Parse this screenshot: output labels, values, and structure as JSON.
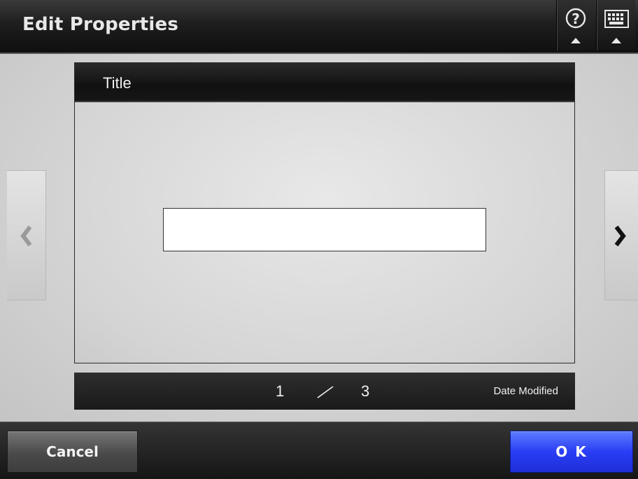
{
  "header": {
    "title": "Edit Properties",
    "help_icon": "help-question-icon",
    "keyboard_icon": "keyboard-icon"
  },
  "panel": {
    "title": "Title",
    "input_value": ""
  },
  "navigation": {
    "prev_icon": "chevron-left-icon",
    "next_icon": "chevron-right-icon"
  },
  "pager": {
    "current": "1",
    "separator": "/",
    "total": "3",
    "field_name": "Date Modified"
  },
  "footer": {
    "cancel_label": "Cancel",
    "ok_label": "O K"
  },
  "colors": {
    "header_bg": "#1e1e1e",
    "ok_button": "#2a3df5",
    "cancel_button": "#4a4a4a"
  }
}
